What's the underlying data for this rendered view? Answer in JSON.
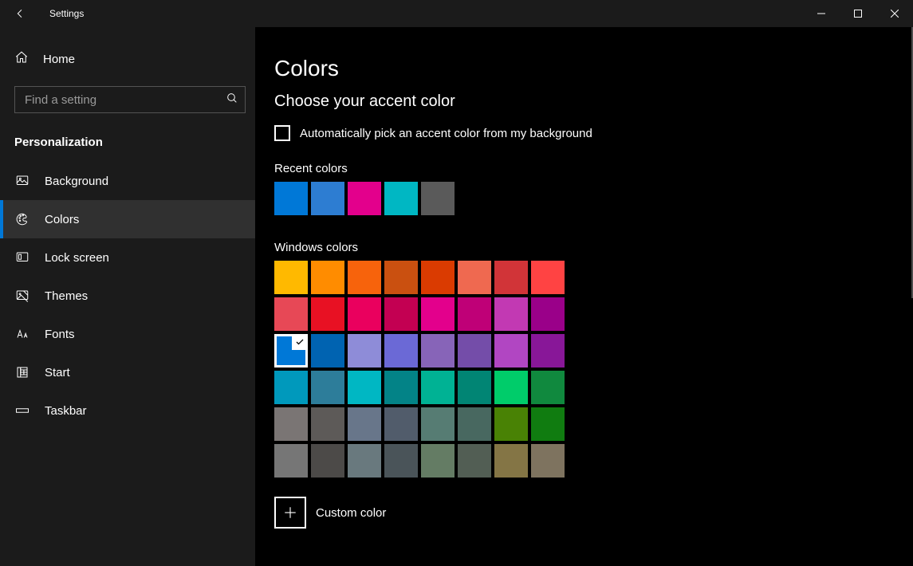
{
  "app": {
    "title": "Settings"
  },
  "sidebar": {
    "home_label": "Home",
    "search_placeholder": "Find a setting",
    "section": "Personalization",
    "items": [
      {
        "label": "Background",
        "selected": false
      },
      {
        "label": "Colors",
        "selected": true
      },
      {
        "label": "Lock screen",
        "selected": false
      },
      {
        "label": "Themes",
        "selected": false
      },
      {
        "label": "Fonts",
        "selected": false
      },
      {
        "label": "Start",
        "selected": false
      },
      {
        "label": "Taskbar",
        "selected": false
      }
    ]
  },
  "content": {
    "page_title": "Colors",
    "subheading": "Choose your accent color",
    "auto_accent_label": "Automatically pick an accent color from my background",
    "auto_accent_checked": false,
    "recent_label": "Recent colors",
    "recent_colors": [
      "#0078d7",
      "#2d7dd2",
      "#e3008c",
      "#00b7c3",
      "#5a5a5a"
    ],
    "windows_colors_label": "Windows colors",
    "windows_colors": [
      "#ffb900",
      "#ff8c00",
      "#f7630c",
      "#ca5010",
      "#da3b01",
      "#ef6950",
      "#d13438",
      "#ff4343",
      "#e74856",
      "#e81123",
      "#ea005e",
      "#c30052",
      "#e3008c",
      "#bf0077",
      "#c239b3",
      "#9a0089",
      "#0078d7",
      "#0063b1",
      "#8e8cd8",
      "#6b69d6",
      "#8764b8",
      "#744da9",
      "#b146c2",
      "#881798",
      "#0099bc",
      "#2d7d9a",
      "#00b7c3",
      "#038387",
      "#00b294",
      "#018574",
      "#00cc6a",
      "#10893e",
      "#7a7574",
      "#5d5a58",
      "#68768a",
      "#515c6b",
      "#567c73",
      "#486860",
      "#498205",
      "#107c10",
      "#767676",
      "#4c4a48",
      "#69797e",
      "#4a5459",
      "#647c64",
      "#525e54",
      "#847545",
      "#7e735f"
    ],
    "selected_color_index": 16,
    "custom_color_label": "Custom color"
  }
}
